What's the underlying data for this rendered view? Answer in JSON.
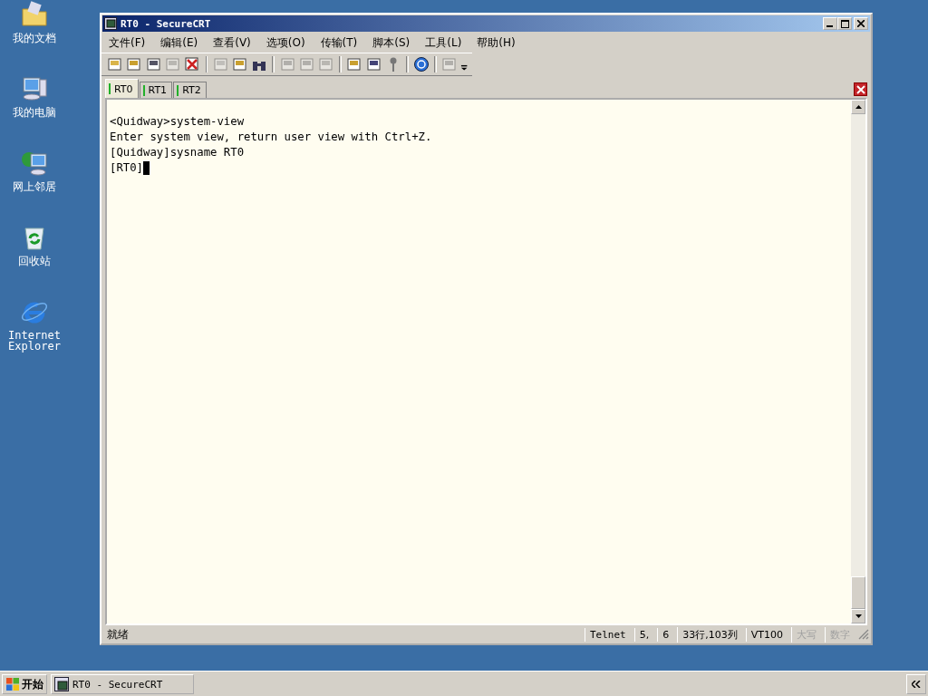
{
  "desktop_icons": [
    {
      "label": "我的文档",
      "kind": "folder"
    },
    {
      "label": "我的电脑",
      "kind": "computer"
    },
    {
      "label": "网上邻居",
      "kind": "network"
    },
    {
      "label": "回收站",
      "kind": "recycle"
    },
    {
      "label": "Internet Explorer",
      "kind": "ie"
    }
  ],
  "window": {
    "title": "RT0 - SecureCRT"
  },
  "menu": [
    "文件(F)",
    "编辑(E)",
    "查看(V)",
    "选项(O)",
    "传输(T)",
    "脚本(S)",
    "工具(L)",
    "帮助(H)"
  ],
  "toolbar": [
    {
      "disabled": false
    },
    {
      "disabled": false
    },
    {
      "disabled": false
    },
    {
      "disabled": true
    },
    {
      "disabled": false
    },
    {
      "disabled": true
    },
    {
      "disabled": false
    },
    {
      "disabled": false
    },
    {
      "disabled": true
    },
    {
      "disabled": true
    },
    {
      "disabled": true
    },
    {
      "disabled": false
    },
    {
      "disabled": false
    },
    {
      "disabled": false
    },
    {
      "disabled": false
    },
    {
      "disabled": true
    }
  ],
  "tabs": [
    {
      "label": "RT0",
      "selected": true
    },
    {
      "label": "RT1",
      "selected": false
    },
    {
      "label": "RT2",
      "selected": false
    }
  ],
  "terminal": {
    "lines": [
      "<Quidway>system-view",
      "Enter system view, return user view with Ctrl+Z.",
      "[Quidway]sysname RT0",
      "[RT0]"
    ]
  },
  "status_bar": {
    "message": "就绪",
    "protocol": "Telnet",
    "row": "5,",
    "col": "6",
    "size": "33行,103列",
    "emulation": "VT100",
    "caps": {
      "label": "大写",
      "disabled": true
    },
    "num": {
      "label": "数字",
      "disabled": true
    }
  },
  "taskbar": {
    "start": "开始",
    "tasks": [
      {
        "label": "RT0 - SecureCRT",
        "selected": false
      }
    ]
  }
}
